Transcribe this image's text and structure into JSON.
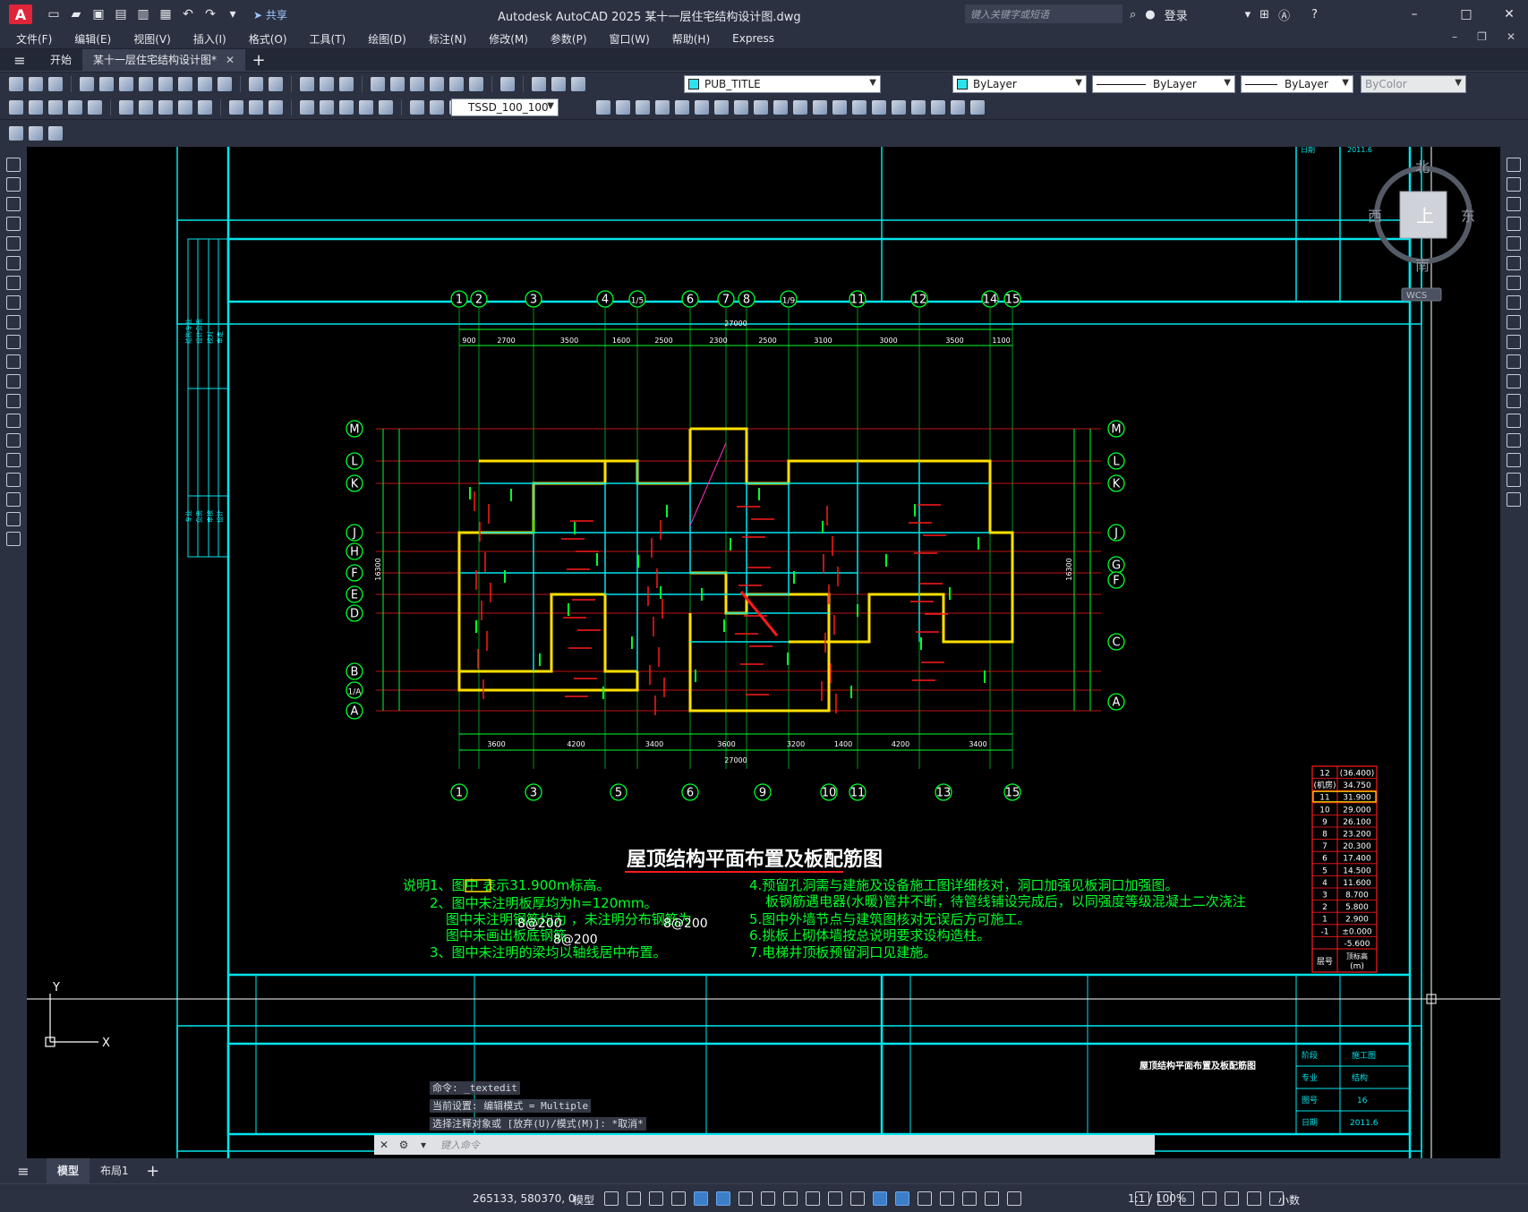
{
  "titlebar": {
    "app_letter": "A",
    "share": "共享",
    "title": "Autodesk AutoCAD 2025    某十一层住宅结构设计图.dwg",
    "search_placeholder": "键入关键字或短语",
    "login": "登录"
  },
  "menu": {
    "items": [
      "文件(F)",
      "编辑(E)",
      "视图(V)",
      "插入(I)",
      "格式(O)",
      "工具(T)",
      "绘图(D)",
      "标注(N)",
      "修改(M)",
      "参数(P)",
      "窗口(W)",
      "帮助(H)",
      "Express"
    ]
  },
  "tabs": {
    "start": "开始",
    "doc": "某十一层住宅结构设计图*"
  },
  "props": {
    "layer": "PUB_TITLE",
    "color": "ByLayer",
    "linetype": "ByLayer",
    "lineweight": "ByLayer",
    "plotstyle": "ByColor",
    "dimstyle": "TSSD_100_100"
  },
  "viewcube": {
    "north": "北",
    "south": "南",
    "east": "东",
    "west": "西",
    "top": "上",
    "wcs": "WCS"
  },
  "drawing": {
    "title": "屋顶结构平面布置及板配筋图",
    "total_dim": "27000",
    "top_axes": [
      "1",
      "2",
      "3",
      "4",
      "1/5",
      "6",
      "7",
      "8",
      "1/9",
      "11",
      "12",
      "14",
      "15"
    ],
    "top_dims": [
      "900",
      "2700",
      "3500",
      "1600",
      "2500",
      "2300",
      "2500",
      "3100",
      "3000",
      "3500",
      "1100"
    ],
    "bottom_axes": [
      "1",
      "3",
      "5",
      "6",
      "9",
      "10",
      "11",
      "13",
      "15"
    ],
    "bottom_dims": [
      "3600",
      "4200",
      "3400",
      "3600",
      "3200",
      "1400",
      "4200",
      "3400"
    ],
    "left_axes": [
      "M",
      "L",
      "K",
      "J",
      "H",
      "F",
      "E",
      "D",
      "B",
      "1/A",
      "A"
    ],
    "right_axes": [
      "M",
      "L",
      "K",
      "J",
      "G",
      "F",
      "C",
      "A"
    ],
    "left_total": "16300",
    "right_total": "16300",
    "notes_left": [
      "说明1、图中        表示31.900m标高。",
      "2、图中未注明板厚均为h=120mm。",
      "图中未注明钢筋均为         ，未注明分布钢筋为",
      "图中未画出板底钢筋",
      "3、图中未注明的梁均以轴线居中布置。"
    ],
    "rebar_a": "8@200",
    "rebar_b": "8@200",
    "rebar_c": "8@200",
    "notes_right": [
      "4.预留孔洞需与建施及设备施工图详细核对，洞口加强见板洞口加强图。",
      "板钢筋遇电器(水暖)管井不断，待管线铺设完成后，以同强度等级混凝土二次浇注",
      "5.图中外墙节点与建筑图核对无误后方可施工。",
      "6.挑板上砌体墙按总说明要求设构造柱。",
      "7.电梯井顶板预留洞口见建施。"
    ],
    "floors": [
      [
        "12",
        "(36.400)"
      ],
      [
        "(机房)",
        "34.750"
      ],
      [
        "11",
        "31.900"
      ],
      [
        "10",
        "29.000"
      ],
      [
        "9",
        "26.100"
      ],
      [
        "8",
        "23.200"
      ],
      [
        "7",
        "20.300"
      ],
      [
        "6",
        "17.400"
      ],
      [
        "5",
        "14.500"
      ],
      [
        "4",
        "11.600"
      ],
      [
        "3",
        "8.700"
      ],
      [
        "2",
        "5.800"
      ],
      [
        "1",
        "2.900"
      ],
      [
        "-1",
        "±0.000"
      ],
      [
        "",
        "-5.600"
      ]
    ],
    "floor_footer": [
      "层号",
      "顶标高",
      "(m)"
    ],
    "titleblock": {
      "drawing_name": "屋顶结构平面布置及板配筋图",
      "labels": [
        "阶段",
        "专业",
        "图号",
        "日期"
      ],
      "values": [
        "施工图",
        "结构",
        "16",
        "2011.6"
      ]
    },
    "top_date": "2011.6",
    "top_label": "日期",
    "sheet_labels": [
      "结构专业",
      "设计负责"
    ],
    "sign_labels": [
      "专业",
      "负责",
      "审核",
      "设计",
      "校对",
      "审定"
    ]
  },
  "command": {
    "hist1": "命令: _textedit",
    "hist2": "当前设置: 编辑模式 = Multiple",
    "hist3": "选择注释对象或 [放弃(U)/模式(M)]: *取消*",
    "placeholder": "键入命令"
  },
  "layout_tabs": {
    "model": "模型",
    "layout1": "布局1"
  },
  "status": {
    "coords": "265133, 580370, 0",
    "model": "模型",
    "scale": "1:1 / 100%",
    "units": "小数"
  },
  "colors": {
    "cyan": "#00e5ee",
    "green": "#00ff2a",
    "red": "#ff1a1a",
    "yellow": "#ffe000",
    "white": "#ffffff",
    "magenta": "#ff30c0"
  }
}
